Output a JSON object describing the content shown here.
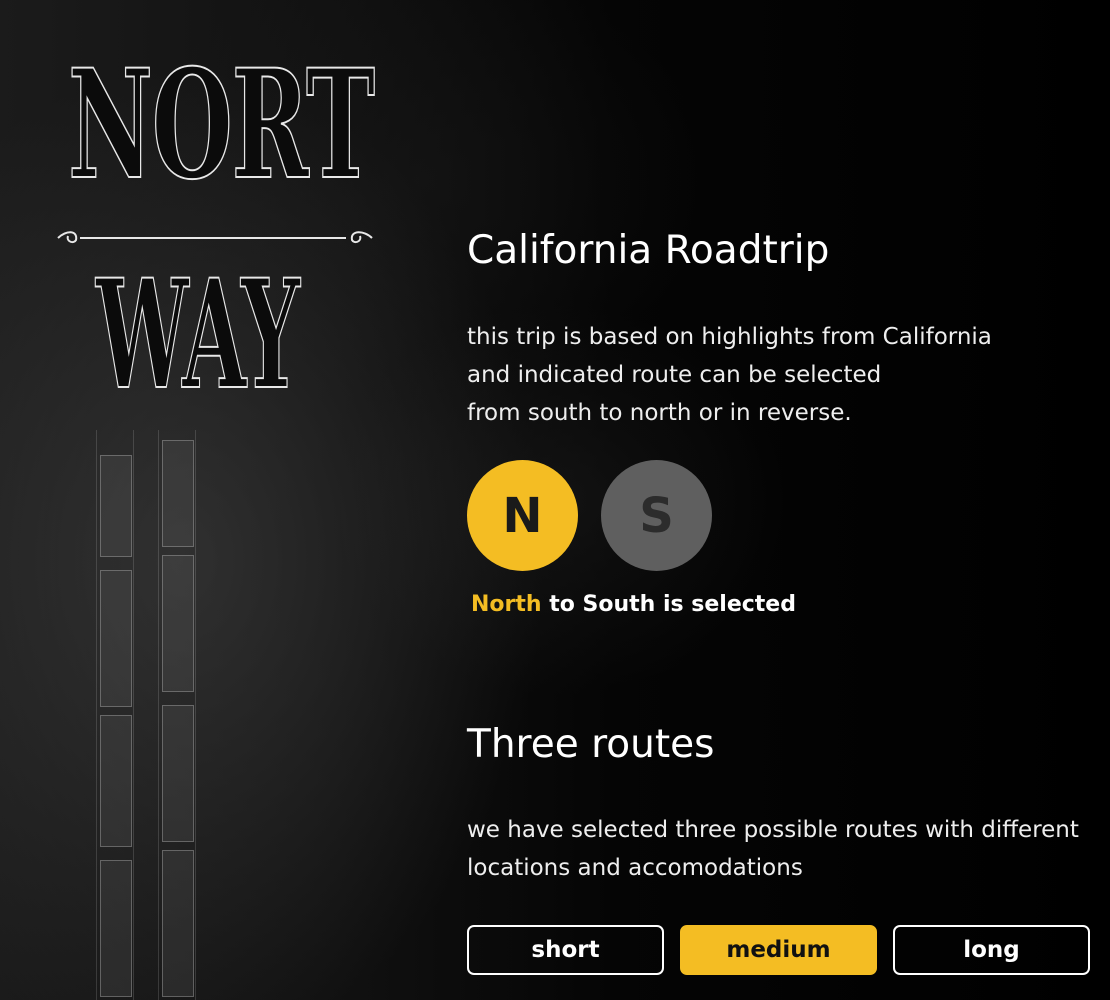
{
  "logo": {
    "text_line1": "NORT",
    "text_line2": "WAY"
  },
  "intro": {
    "title": "California Roadtrip",
    "description_lines": [
      "this trip is based on highlights from California",
      "and indicated route can be selected",
      "from south to north or in reverse."
    ]
  },
  "direction": {
    "north_label": "N",
    "south_label": "S",
    "selected": "north",
    "status_highlight": "North",
    "status_rest": " to South is selected"
  },
  "routes": {
    "title": "Three routes",
    "description_lines": [
      "we have selected three possible routes with different",
      "locations and accomodations"
    ],
    "options": [
      "short",
      "medium",
      "long"
    ],
    "selected": "medium"
  },
  "colors": {
    "accent": "#f4bd23",
    "inactive": "#5f5f5f",
    "background": "#000000"
  }
}
